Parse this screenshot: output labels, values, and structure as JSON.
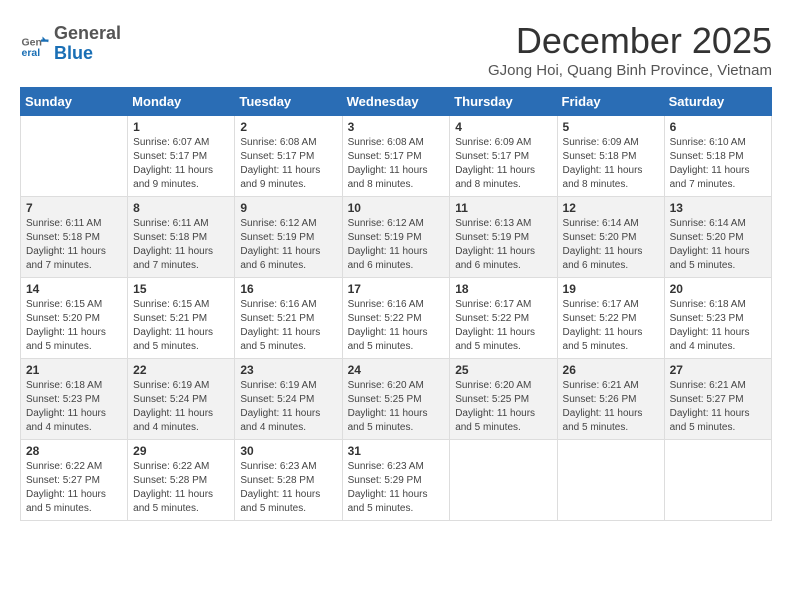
{
  "header": {
    "logo": {
      "general": "General",
      "blue": "Blue"
    },
    "title": "December 2025",
    "location": "GJong Hoi, Quang Binh Province, Vietnam"
  },
  "calendar": {
    "days_of_week": [
      "Sunday",
      "Monday",
      "Tuesday",
      "Wednesday",
      "Thursday",
      "Friday",
      "Saturday"
    ],
    "weeks": [
      [
        {
          "day": "",
          "info": ""
        },
        {
          "day": "1",
          "info": "Sunrise: 6:07 AM\nSunset: 5:17 PM\nDaylight: 11 hours\nand 9 minutes."
        },
        {
          "day": "2",
          "info": "Sunrise: 6:08 AM\nSunset: 5:17 PM\nDaylight: 11 hours\nand 9 minutes."
        },
        {
          "day": "3",
          "info": "Sunrise: 6:08 AM\nSunset: 5:17 PM\nDaylight: 11 hours\nand 8 minutes."
        },
        {
          "day": "4",
          "info": "Sunrise: 6:09 AM\nSunset: 5:17 PM\nDaylight: 11 hours\nand 8 minutes."
        },
        {
          "day": "5",
          "info": "Sunrise: 6:09 AM\nSunset: 5:18 PM\nDaylight: 11 hours\nand 8 minutes."
        },
        {
          "day": "6",
          "info": "Sunrise: 6:10 AM\nSunset: 5:18 PM\nDaylight: 11 hours\nand 7 minutes."
        }
      ],
      [
        {
          "day": "7",
          "info": "Sunrise: 6:11 AM\nSunset: 5:18 PM\nDaylight: 11 hours\nand 7 minutes."
        },
        {
          "day": "8",
          "info": "Sunrise: 6:11 AM\nSunset: 5:18 PM\nDaylight: 11 hours\nand 7 minutes."
        },
        {
          "day": "9",
          "info": "Sunrise: 6:12 AM\nSunset: 5:19 PM\nDaylight: 11 hours\nand 6 minutes."
        },
        {
          "day": "10",
          "info": "Sunrise: 6:12 AM\nSunset: 5:19 PM\nDaylight: 11 hours\nand 6 minutes."
        },
        {
          "day": "11",
          "info": "Sunrise: 6:13 AM\nSunset: 5:19 PM\nDaylight: 11 hours\nand 6 minutes."
        },
        {
          "day": "12",
          "info": "Sunrise: 6:14 AM\nSunset: 5:20 PM\nDaylight: 11 hours\nand 6 minutes."
        },
        {
          "day": "13",
          "info": "Sunrise: 6:14 AM\nSunset: 5:20 PM\nDaylight: 11 hours\nand 5 minutes."
        }
      ],
      [
        {
          "day": "14",
          "info": "Sunrise: 6:15 AM\nSunset: 5:20 PM\nDaylight: 11 hours\nand 5 minutes."
        },
        {
          "day": "15",
          "info": "Sunrise: 6:15 AM\nSunset: 5:21 PM\nDaylight: 11 hours\nand 5 minutes."
        },
        {
          "day": "16",
          "info": "Sunrise: 6:16 AM\nSunset: 5:21 PM\nDaylight: 11 hours\nand 5 minutes."
        },
        {
          "day": "17",
          "info": "Sunrise: 6:16 AM\nSunset: 5:22 PM\nDaylight: 11 hours\nand 5 minutes."
        },
        {
          "day": "18",
          "info": "Sunrise: 6:17 AM\nSunset: 5:22 PM\nDaylight: 11 hours\nand 5 minutes."
        },
        {
          "day": "19",
          "info": "Sunrise: 6:17 AM\nSunset: 5:22 PM\nDaylight: 11 hours\nand 5 minutes."
        },
        {
          "day": "20",
          "info": "Sunrise: 6:18 AM\nSunset: 5:23 PM\nDaylight: 11 hours\nand 4 minutes."
        }
      ],
      [
        {
          "day": "21",
          "info": "Sunrise: 6:18 AM\nSunset: 5:23 PM\nDaylight: 11 hours\nand 4 minutes."
        },
        {
          "day": "22",
          "info": "Sunrise: 6:19 AM\nSunset: 5:24 PM\nDaylight: 11 hours\nand 4 minutes."
        },
        {
          "day": "23",
          "info": "Sunrise: 6:19 AM\nSunset: 5:24 PM\nDaylight: 11 hours\nand 4 minutes."
        },
        {
          "day": "24",
          "info": "Sunrise: 6:20 AM\nSunset: 5:25 PM\nDaylight: 11 hours\nand 5 minutes."
        },
        {
          "day": "25",
          "info": "Sunrise: 6:20 AM\nSunset: 5:25 PM\nDaylight: 11 hours\nand 5 minutes."
        },
        {
          "day": "26",
          "info": "Sunrise: 6:21 AM\nSunset: 5:26 PM\nDaylight: 11 hours\nand 5 minutes."
        },
        {
          "day": "27",
          "info": "Sunrise: 6:21 AM\nSunset: 5:27 PM\nDaylight: 11 hours\nand 5 minutes."
        }
      ],
      [
        {
          "day": "28",
          "info": "Sunrise: 6:22 AM\nSunset: 5:27 PM\nDaylight: 11 hours\nand 5 minutes."
        },
        {
          "day": "29",
          "info": "Sunrise: 6:22 AM\nSunset: 5:28 PM\nDaylight: 11 hours\nand 5 minutes."
        },
        {
          "day": "30",
          "info": "Sunrise: 6:23 AM\nSunset: 5:28 PM\nDaylight: 11 hours\nand 5 minutes."
        },
        {
          "day": "31",
          "info": "Sunrise: 6:23 AM\nSunset: 5:29 PM\nDaylight: 11 hours\nand 5 minutes."
        },
        {
          "day": "",
          "info": ""
        },
        {
          "day": "",
          "info": ""
        },
        {
          "day": "",
          "info": ""
        }
      ]
    ]
  }
}
